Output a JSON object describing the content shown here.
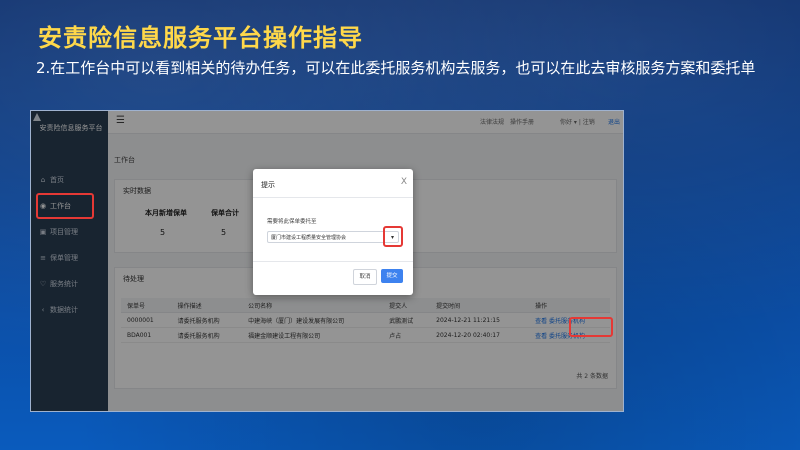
{
  "slide": {
    "title": "安责险信息服务平台操作指导",
    "description": "2.在工作台中可以看到相关的待办任务，可以在此委托服务机构去服务，也可以在此去审核服务方案和委托单"
  },
  "app": {
    "brand": "安责险信息服务平台",
    "nav": [
      {
        "icon": "home-icon",
        "label": "首页"
      },
      {
        "icon": "workbench-icon",
        "label": "工作台"
      },
      {
        "icon": "project-icon",
        "label": "项目管理"
      },
      {
        "icon": "policy-icon",
        "label": "保单管理"
      },
      {
        "icon": "service-icon",
        "label": "服务统计"
      },
      {
        "icon": "stats-icon",
        "label": "数据统计"
      }
    ],
    "topbar": {
      "links": [
        "法律法规",
        "操作手册"
      ],
      "user": "你好 ▾ | 注销",
      "exit": "退出"
    },
    "breadcrumb": "工作台",
    "stats_panel": {
      "title": "实时数据",
      "items": [
        {
          "label": "本月新增保单",
          "value": "5"
        },
        {
          "label": "保单合计",
          "value": "5"
        }
      ]
    },
    "todo_panel": {
      "title": "待处理",
      "columns": [
        "保单号",
        "操作描述",
        "公司名称",
        "提交人",
        "提交时间",
        "操作"
      ],
      "rows": [
        {
          "no": "0000001",
          "desc": "请委托服务机构",
          "company": "中建海峡（厦门）建设发展有限公司",
          "user": "武鹏测试",
          "time": "2024-12-21 11:21:15",
          "actions": [
            "查看",
            "委托服务机构"
          ]
        },
        {
          "no": "BDA001",
          "desc": "请委托服务机构",
          "company": "福建金顺建设工程有限公司",
          "user": "卢占",
          "time": "2024-12-20 02:40:17",
          "actions": [
            "查看",
            "委托服务机构"
          ]
        }
      ],
      "pager": "共 2 条数据"
    },
    "dialog": {
      "title": "提示",
      "close": "X",
      "label": "需要将此保单委托至",
      "select_value": "厦门市建设工程质量安全管理协会",
      "cancel": "取消",
      "confirm": "提交"
    }
  },
  "colors": {
    "title": "#ffd84a",
    "highlight": "#e53935",
    "primary": "#3d82ef"
  }
}
